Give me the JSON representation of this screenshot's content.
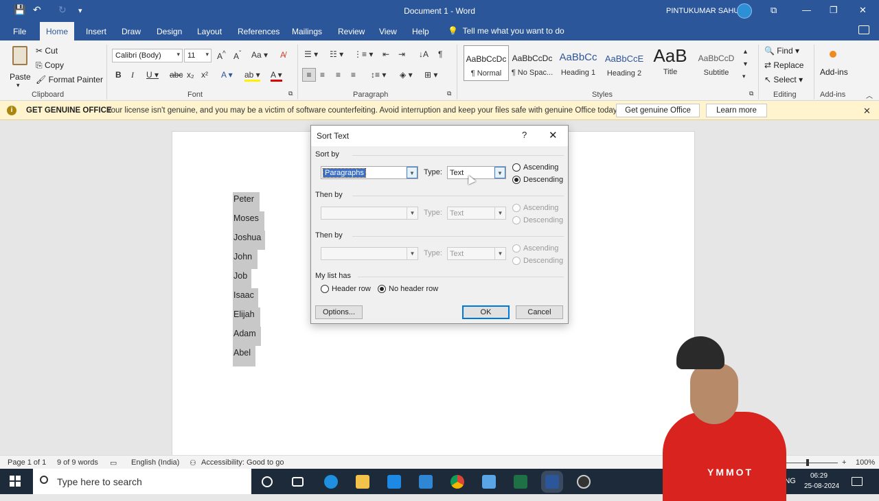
{
  "titlebar": {
    "doc_title": "Document 1  -  Word",
    "user": "PINTUKUMAR SAHU"
  },
  "menu": {
    "tabs": [
      "File",
      "Home",
      "Insert",
      "Draw",
      "Design",
      "Layout",
      "References",
      "Mailings",
      "Review",
      "View",
      "Help"
    ],
    "active": "Home",
    "tell_me": "Tell me what you want to do"
  },
  "ribbon": {
    "clipboard": {
      "paste": "Paste",
      "cut": "Cut",
      "copy": "Copy",
      "format_painter": "Format Painter",
      "label": "Clipboard"
    },
    "font": {
      "name": "Calibri (Body)",
      "size": "11",
      "label": "Font"
    },
    "paragraph": {
      "label": "Paragraph"
    },
    "styles": {
      "label": "Styles",
      "items": [
        {
          "sample": "AaBbCcDc",
          "name": "¶ Normal"
        },
        {
          "sample": "AaBbCcDc",
          "name": "¶ No Spac..."
        },
        {
          "sample": "AaBbCc",
          "name": "Heading 1"
        },
        {
          "sample": "AaBbCcE",
          "name": "Heading 2"
        },
        {
          "sample": "AaB",
          "name": "Title"
        },
        {
          "sample": "AaBbCcD",
          "name": "Subtitle"
        }
      ]
    },
    "editing": {
      "find": "Find",
      "replace": "Replace",
      "select": "Select",
      "label": "Editing"
    },
    "addins": {
      "button": "Add-ins",
      "label": "Add-ins"
    }
  },
  "banner": {
    "title": "GET GENUINE OFFICE",
    "message": "Your license isn't genuine, and you may be a victim of software counterfeiting. Avoid interruption and keep your files safe with genuine Office today.",
    "btn_genuine": "Get genuine Office",
    "btn_learn": "Learn more"
  },
  "document": {
    "names": [
      "Peter",
      "Moses",
      "Joshua",
      "John",
      "Job",
      "Isaac",
      "Elijah",
      "Adam",
      "Abel"
    ]
  },
  "dialog": {
    "title": "Sort Text",
    "help": "?",
    "sort_by_label": "Sort by",
    "sort_by_value": "Paragraphs",
    "type_label": "Type:",
    "type_value": "Text",
    "ascending": "Ascending",
    "descending": "Descending",
    "then_by_label": "Then by",
    "then_type_value": "Text",
    "my_list_has": "My list has",
    "header_row": "Header row",
    "no_header_row": "No header row",
    "options": "Options...",
    "ok": "OK",
    "cancel": "Cancel"
  },
  "status": {
    "page": "Page 1 of 1",
    "words": "9 of 9 words",
    "language": "English (India)",
    "accessibility": "Accessibility: Good to go",
    "zoom": "100%"
  },
  "taskbar": {
    "search_placeholder": "Type here to search",
    "lang": "ENG",
    "time": "06:29",
    "date": "25-08-2024"
  },
  "overlay": {
    "shirt_text": "YMMOT"
  }
}
